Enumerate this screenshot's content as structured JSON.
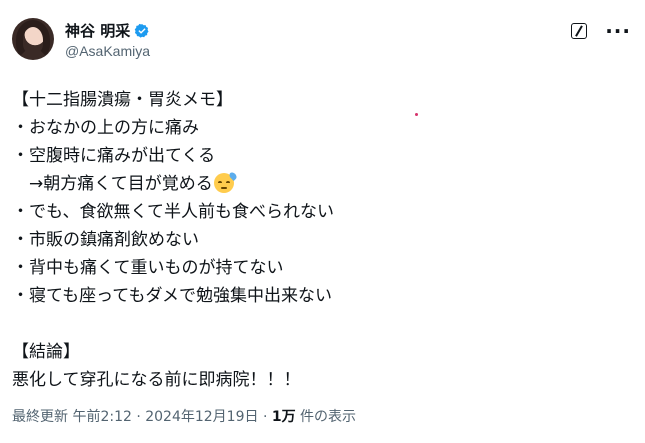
{
  "author": {
    "name": "神谷 明采",
    "handle": "@AsaKamiya",
    "verified": true
  },
  "icons": {
    "verified": "verified-badge-icon",
    "edit": "edit-icon",
    "more": "more-options-icon",
    "emoji": "sweat-face-emoji",
    "accent_color": "#1d9bf0"
  },
  "tweet": {
    "lines": [
      "【十二指腸潰瘍・胃炎メモ】",
      "・おなかの上の方に痛み",
      "・空腹時に痛みが出てくる",
      "　→朝方痛くて目が覚める",
      "・でも、食欲無くて半人前も食べられない",
      "・市販の鎮痛剤飲めない",
      "・背中も痛くて重いものが持てない",
      "・寝ても座ってもダメで勉強集中出来ない",
      "",
      "【結論】",
      "悪化して穿孔になる前に即病院！！！"
    ]
  },
  "meta": {
    "prefix": "最終更新 午前2:12 · 2024年12月19日 · ",
    "views_count": "1万",
    "views_suffix": " 件の表示"
  }
}
